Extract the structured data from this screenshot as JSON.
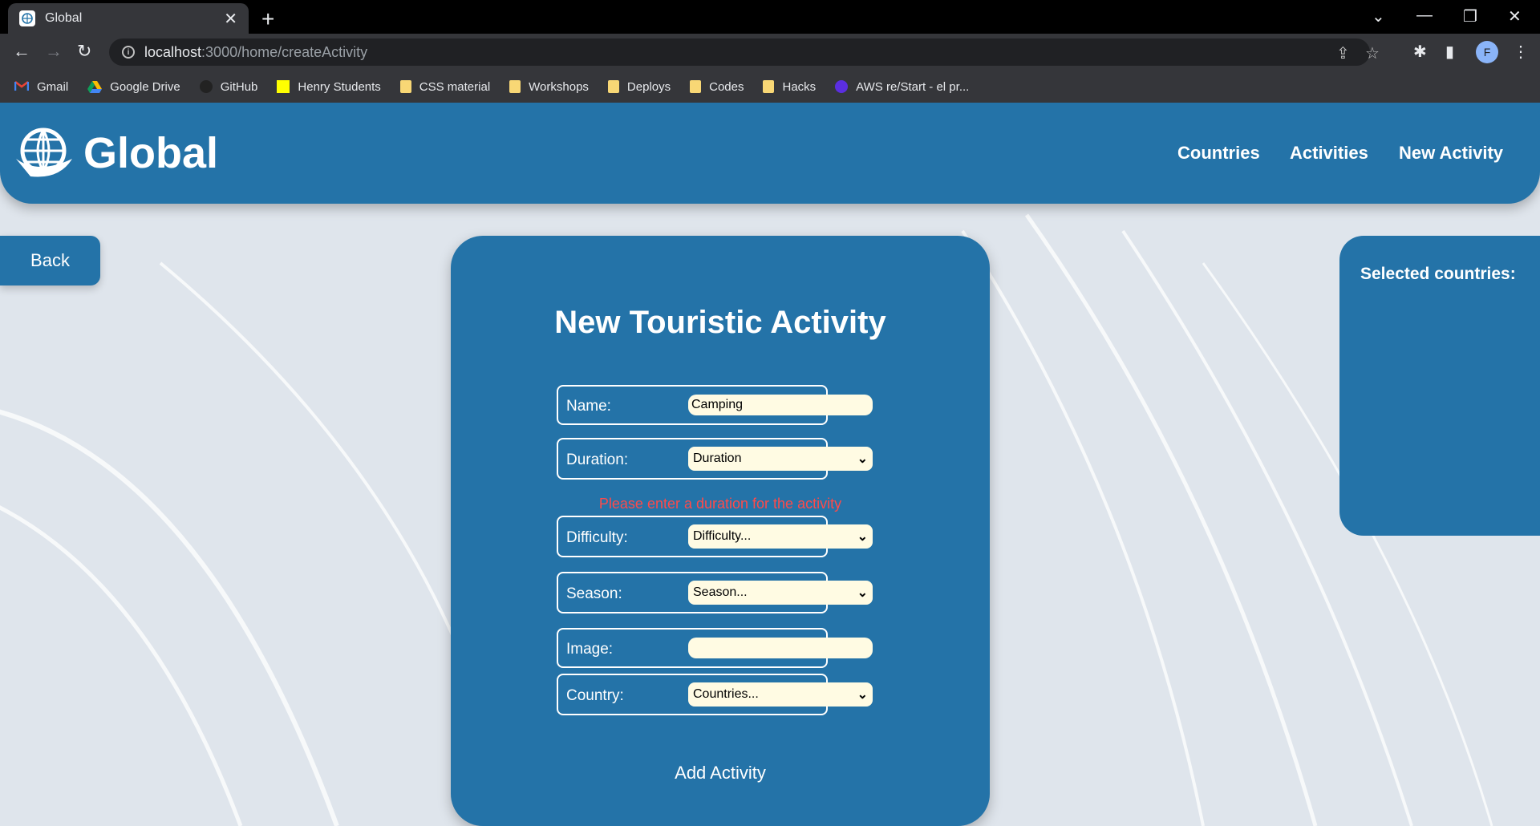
{
  "browser": {
    "tab_title": "Global",
    "url_host": "localhost",
    "url_path": ":3000/home/createActivity",
    "profile_initial": "F",
    "bookmarks": [
      {
        "label": "Gmail",
        "icon": "gmail-icon"
      },
      {
        "label": "Google Drive",
        "icon": "google-drive-icon"
      },
      {
        "label": "GitHub",
        "icon": "github-icon"
      },
      {
        "label": "Henry Students",
        "icon": "henry-icon"
      },
      {
        "label": "CSS material",
        "icon": "folder-icon"
      },
      {
        "label": "Workshops",
        "icon": "folder-icon"
      },
      {
        "label": "Deploys",
        "icon": "folder-icon"
      },
      {
        "label": "Codes",
        "icon": "folder-icon"
      },
      {
        "label": "Hacks",
        "icon": "folder-icon"
      },
      {
        "label": "AWS re/Start - el pr...",
        "icon": "aws-icon"
      }
    ]
  },
  "header": {
    "logo_text": "Global",
    "nav": {
      "countries": "Countries",
      "activities": "Activities",
      "new_activity": "New Activity"
    }
  },
  "back_label": "Back",
  "form": {
    "title": "New Touristic Activity",
    "name_label": "Name:",
    "name_value": "Camping",
    "duration_label": "Duration:",
    "duration_value": "Duration",
    "error": "Please enter a duration for the activity",
    "difficulty_label": "Difficulty:",
    "difficulty_value": "Difficulty...",
    "season_label": "Season:",
    "season_value": "Season...",
    "image_label": "Image:",
    "image_value": "",
    "country_label": "Country:",
    "country_value": "Countries...",
    "submit": "Add Activity"
  },
  "selected": {
    "title": "Selected countries:"
  },
  "colors": {
    "brand": "#2473a8",
    "error": "#ff4a4a",
    "input_bg": "#fffbe3"
  }
}
